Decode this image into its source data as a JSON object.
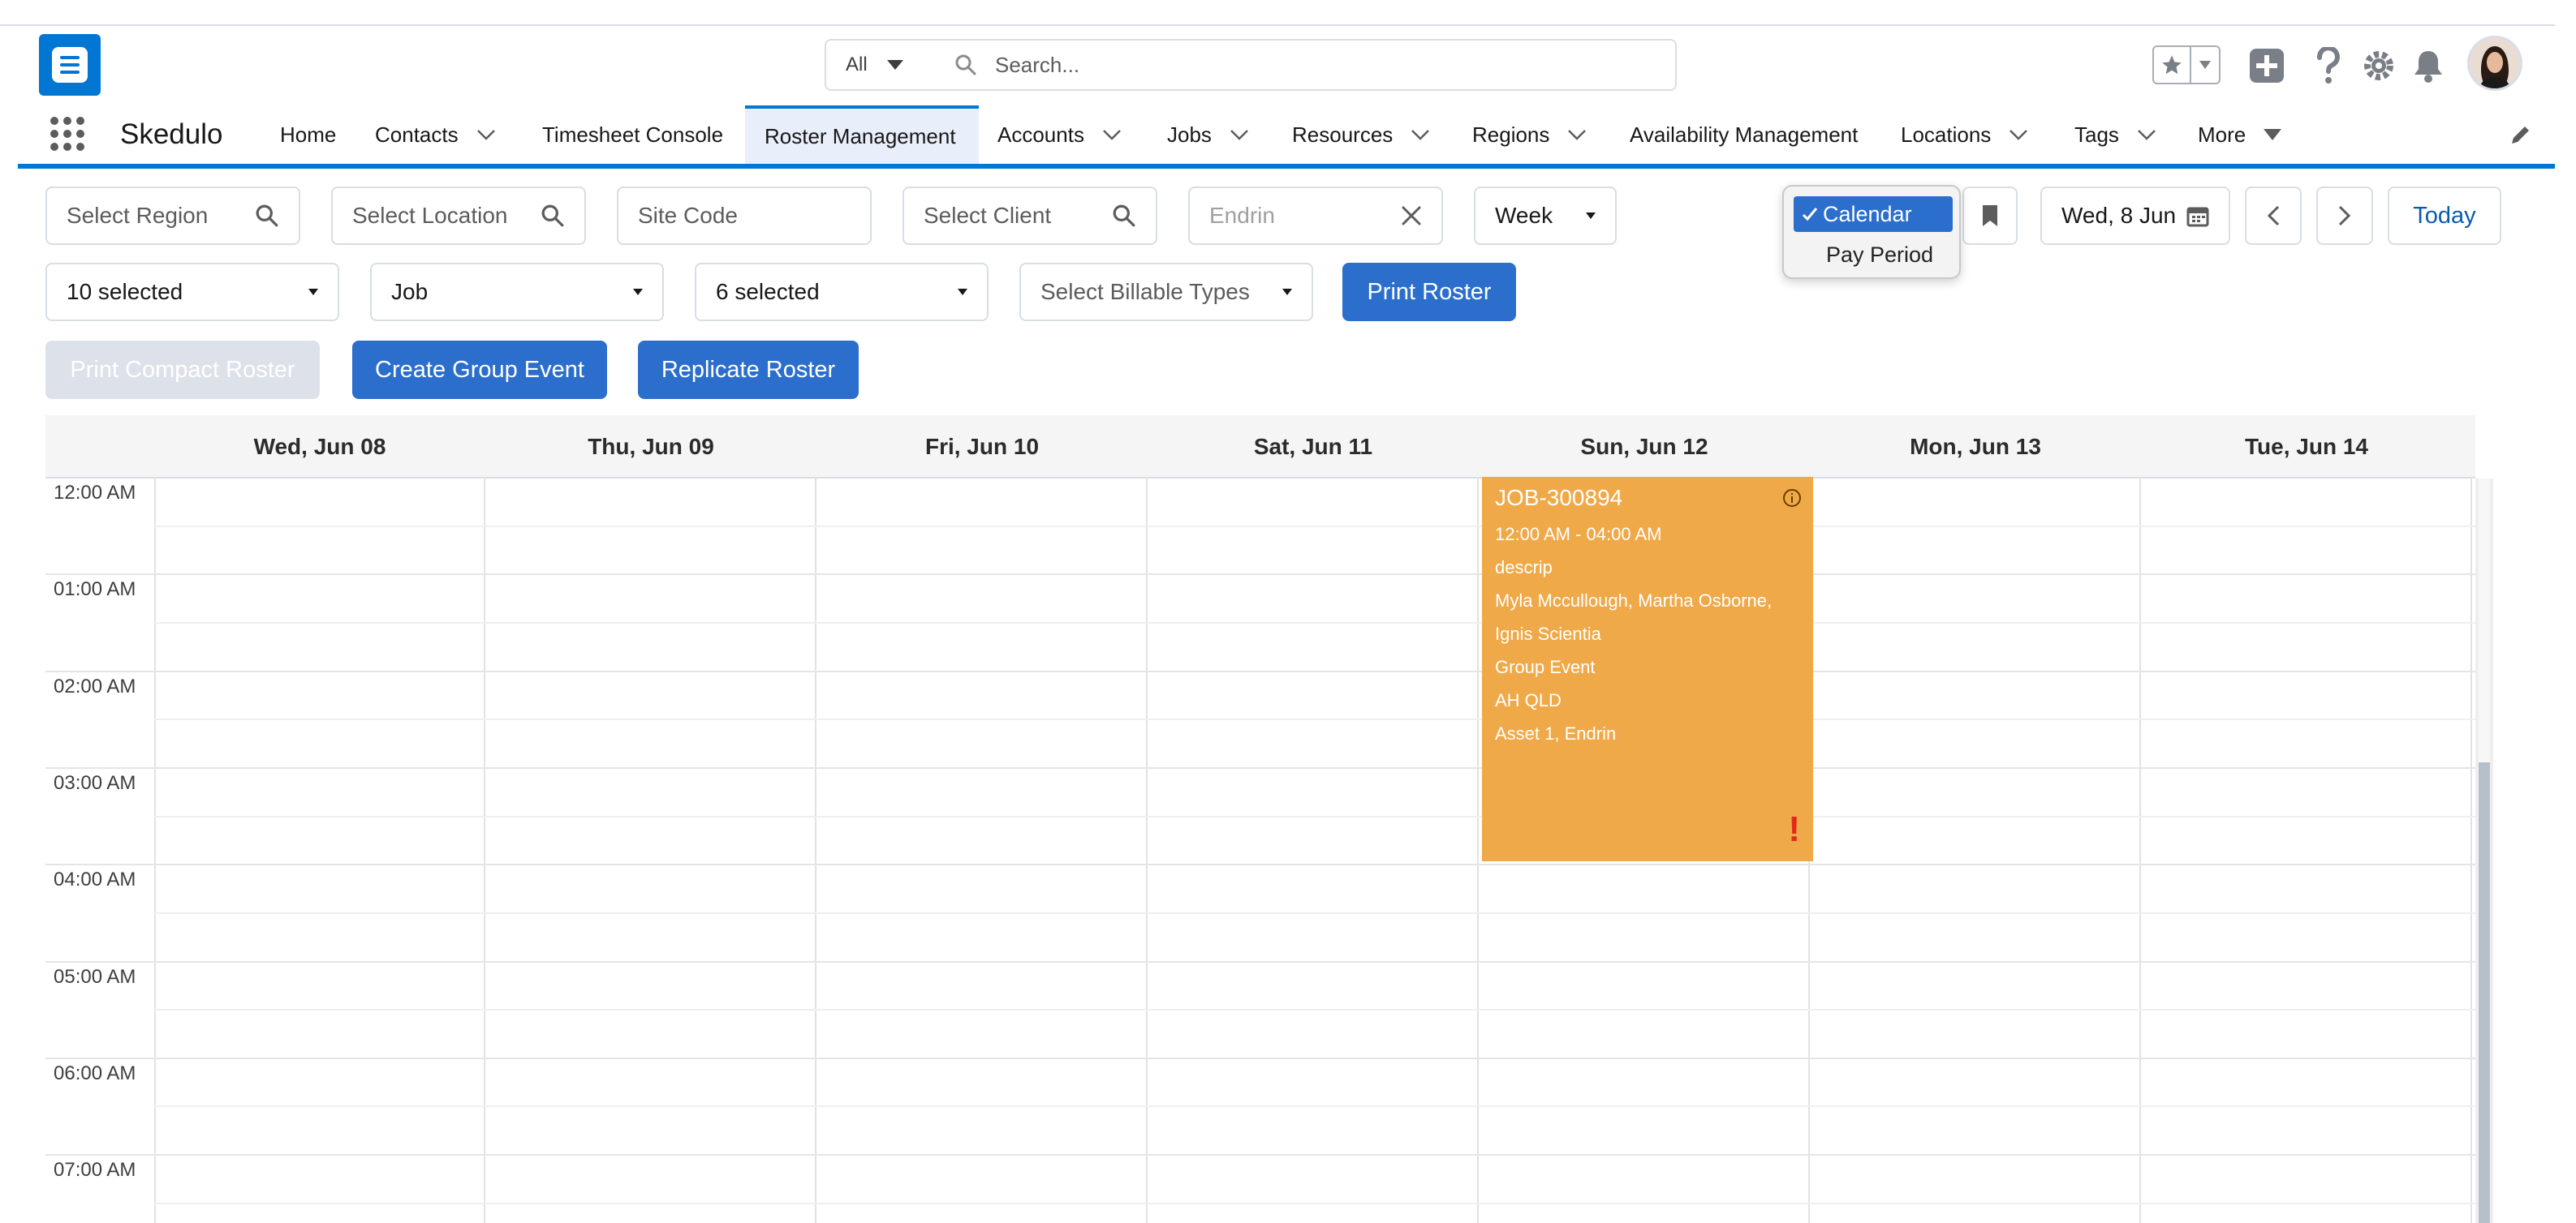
{
  "header": {
    "search_scope": "All",
    "search_placeholder": "Search..."
  },
  "nav": {
    "app_name": "Skedulo",
    "items": [
      {
        "label": "Home",
        "has_menu": false
      },
      {
        "label": "Contacts",
        "has_menu": true
      },
      {
        "label": "Timesheet Console",
        "has_menu": false
      },
      {
        "label": "Roster Management",
        "has_menu": false,
        "active": true
      },
      {
        "label": "Accounts",
        "has_menu": true
      },
      {
        "label": "Jobs",
        "has_menu": true
      },
      {
        "label": "Resources",
        "has_menu": true
      },
      {
        "label": "Regions",
        "has_menu": true
      },
      {
        "label": "Availability Management",
        "has_menu": false
      },
      {
        "label": "Locations",
        "has_menu": true
      },
      {
        "label": "Tags",
        "has_menu": true
      },
      {
        "label": "More",
        "has_menu": true
      }
    ]
  },
  "filters": {
    "region_placeholder": "Select Region",
    "location_placeholder": "Select Location",
    "site_code_placeholder": "Site Code",
    "client_placeholder": "Select Client",
    "resource_value": "Endrin",
    "view_range": "Week",
    "status_selected": "10 selected",
    "type_selected": "Job",
    "category_selected": "6 selected",
    "billable_placeholder": "Select Billable Types",
    "date_value": "Wed, 8 Jun"
  },
  "buttons": {
    "print_roster": "Print Roster",
    "print_compact": "Print Compact Roster",
    "create_group": "Create Group Event",
    "replicate": "Replicate Roster",
    "today": "Today"
  },
  "view_menu": {
    "selected": "Calendar",
    "other": "Pay Period"
  },
  "calendar": {
    "days": [
      "Wed, Jun 08",
      "Thu, Jun 09",
      "Fri, Jun 10",
      "Sat, Jun 11",
      "Sun, Jun 12",
      "Mon, Jun 13",
      "Tue, Jun 14"
    ],
    "hours": [
      "12:00 AM",
      "01:00 AM",
      "02:00 AM",
      "03:00 AM",
      "04:00 AM",
      "05:00 AM",
      "06:00 AM",
      "07:00 AM"
    ]
  },
  "event": {
    "title": "JOB-300894",
    "time": "12:00 AM - 04:00 AM",
    "description": "descrip",
    "resources_line1": "Myla Mccullough, Martha Osborne,",
    "resources_line2": "Ignis Scientia",
    "type": "Group Event",
    "region": "AH QLD",
    "assets": "Asset 1, Endrin",
    "warning": "!",
    "color": "#f0a948"
  },
  "colors": {
    "brand": "#0176d3",
    "button": "#2c6ecb"
  }
}
